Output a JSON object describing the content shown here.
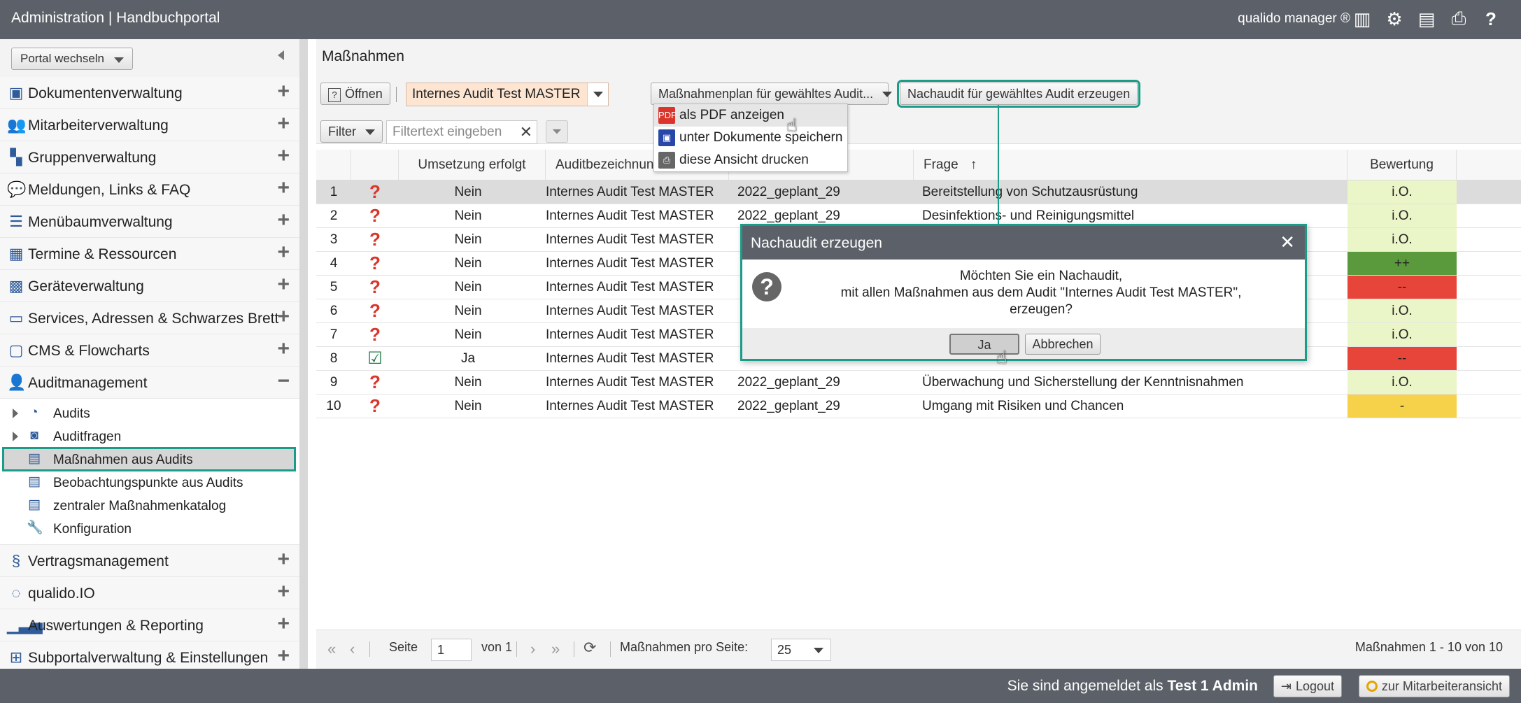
{
  "header": {
    "title": "Administration | Handbuchportal",
    "brand": "qualido manager ®",
    "icons": [
      "barcode-icon",
      "settings-icon",
      "print-list-icon",
      "printer-icon",
      "help-icon"
    ]
  },
  "sidebar": {
    "portal_switch": "Portal wechseln",
    "items": [
      {
        "label": "Dokumentenverwaltung",
        "icon": "documents-icon"
      },
      {
        "label": "Mitarbeiterverwaltung",
        "icon": "users-icon"
      },
      {
        "label": "Gruppenverwaltung",
        "icon": "groups-icon"
      },
      {
        "label": "Meldungen, Links & FAQ",
        "icon": "speech-bubble-icon"
      },
      {
        "label": "Menübaumverwaltung",
        "icon": "list-icon"
      },
      {
        "label": "Termine & Ressourcen",
        "icon": "calendar-icon"
      },
      {
        "label": "Geräteverwaltung",
        "icon": "device-icon"
      },
      {
        "label": "Services, Adressen & Schwarzes Brett",
        "icon": "board-icon"
      },
      {
        "label": "CMS & Flowcharts",
        "icon": "cms-icon"
      },
      {
        "label": "Auditmanagement",
        "icon": "audit-user-icon"
      }
    ],
    "audit_sub": [
      {
        "label": "Audits",
        "icon": "ear-icon"
      },
      {
        "label": "Auditfragen",
        "icon": "search-doc-icon"
      },
      {
        "label": "Maßnahmen aus Audits",
        "icon": "doc-list-icon"
      },
      {
        "label": "Beobachtungspunkte aus Audits",
        "icon": "doc-list-icon"
      },
      {
        "label": "zentraler Maßnahmenkatalog",
        "icon": "doc-list-icon"
      },
      {
        "label": "Konfiguration",
        "icon": "wrench-icon"
      }
    ],
    "items_after": [
      {
        "label": "Vertragsmanagement",
        "icon": "paragraph-icon"
      },
      {
        "label": "qualido.IO",
        "icon": "io-icon"
      },
      {
        "label": "Auswertungen & Reporting",
        "icon": "bar-chart-icon"
      },
      {
        "label": "Subportalverwaltung & Einstellungen",
        "icon": "sitemap-icon"
      }
    ]
  },
  "main": {
    "title": "Maßnahmen",
    "toolbar": {
      "open_label": "Öffnen",
      "audit_combo": "Internes Audit Test MASTER",
      "plan_button": "Maßnahmenplan für gewähltes Audit...",
      "nachaudit_button": "Nachaudit für gewähltes Audit erzeugen",
      "filter_button": "Filter",
      "filter_placeholder": "Filtertext eingeben"
    },
    "menu": [
      {
        "label": "als PDF anzeigen",
        "icon": "pdf-icon"
      },
      {
        "label": "unter Dokumente speichern",
        "icon": "floppy-icon"
      },
      {
        "label": "diese Ansicht drucken",
        "icon": "printer-icon"
      }
    ],
    "columns": [
      "Umsetzung erfolgt",
      "Auditbezeichnung",
      "Frage",
      "Bewertung"
    ],
    "rows": [
      {
        "num": "1",
        "status": "question",
        "ums": "Nein",
        "aud": "Internes Audit Test MASTER",
        "ges": "2022_geplant_29",
        "fra": "Bereitstellung von Schutzausrüstung",
        "bew": "i.O.",
        "bew_color": "#eaf5c8"
      },
      {
        "num": "2",
        "status": "question",
        "ums": "Nein",
        "aud": "Internes Audit Test MASTER",
        "ges": "2022_geplant_29",
        "fra": "Desinfektions- und Reinigungsmittel",
        "bew": "i.O.",
        "bew_color": "#eaf5c8"
      },
      {
        "num": "3",
        "status": "question",
        "ums": "Nein",
        "aud": "Internes Audit Test MASTER",
        "ges": "",
        "fra": "",
        "bew": "i.O.",
        "bew_color": "#eaf5c8"
      },
      {
        "num": "4",
        "status": "question",
        "ums": "Nein",
        "aud": "Internes Audit Test MASTER",
        "ges": "",
        "fra": "",
        "bew": "++",
        "bew_color": "#5b9a3c"
      },
      {
        "num": "5",
        "status": "question",
        "ums": "Nein",
        "aud": "Internes Audit Test MASTER",
        "ges": "",
        "fra": "",
        "bew": "--",
        "bew_color": "#e8453a"
      },
      {
        "num": "6",
        "status": "question",
        "ums": "Nein",
        "aud": "Internes Audit Test MASTER",
        "ges": "",
        "fra": "",
        "bew": "i.O.",
        "bew_color": "#eaf5c8"
      },
      {
        "num": "7",
        "status": "question",
        "ums": "Nein",
        "aud": "Internes Audit Test MASTER",
        "ges": "",
        "fra": "",
        "bew": "i.O.",
        "bew_color": "#eaf5c8"
      },
      {
        "num": "8",
        "status": "check",
        "ums": "Ja",
        "aud": "Internes Audit Test MASTER",
        "ges": "",
        "fra": "",
        "bew": "--",
        "bew_color": "#e8453a"
      },
      {
        "num": "9",
        "status": "question",
        "ums": "Nein",
        "aud": "Internes Audit Test MASTER",
        "ges": "2022_geplant_29",
        "fra": "Überwachung und Sicherstellung der Kenntnisnahmen",
        "bew": "i.O.",
        "bew_color": "#eaf5c8"
      },
      {
        "num": "10",
        "status": "question",
        "ums": "Nein",
        "aud": "Internes Audit Test MASTER",
        "ges": "2022_geplant_29",
        "fra": "Umgang mit Risiken und Chancen",
        "bew": "-",
        "bew_color": "#f5d24a"
      }
    ],
    "pager": {
      "page_label": "Seite",
      "page_value": "1",
      "of_label": "von 1",
      "per_page_label": "Maßnahmen pro Seite:",
      "per_page_value": "25",
      "summary": "Maßnahmen 1 - 10 von 10"
    }
  },
  "dialog": {
    "title": "Nachaudit erzeugen",
    "line1": "Möchten Sie ein Nachaudit,",
    "line2": "mit allen Maßnahmen aus dem Audit \"Internes Audit Test MASTER\",",
    "line3": "erzeugen?",
    "yes": "Ja",
    "cancel": "Abbrechen"
  },
  "footer": {
    "logged_prefix": "Sie sind angemeldet als",
    "user": "Test 1 Admin",
    "logout": "Logout",
    "employee_view": "zur Mitarbeiteransicht"
  },
  "colors": {
    "accent": "#1a9c88",
    "header_bg": "#5c6169",
    "question": "#d9352a",
    "check": "#1b7a3e"
  }
}
